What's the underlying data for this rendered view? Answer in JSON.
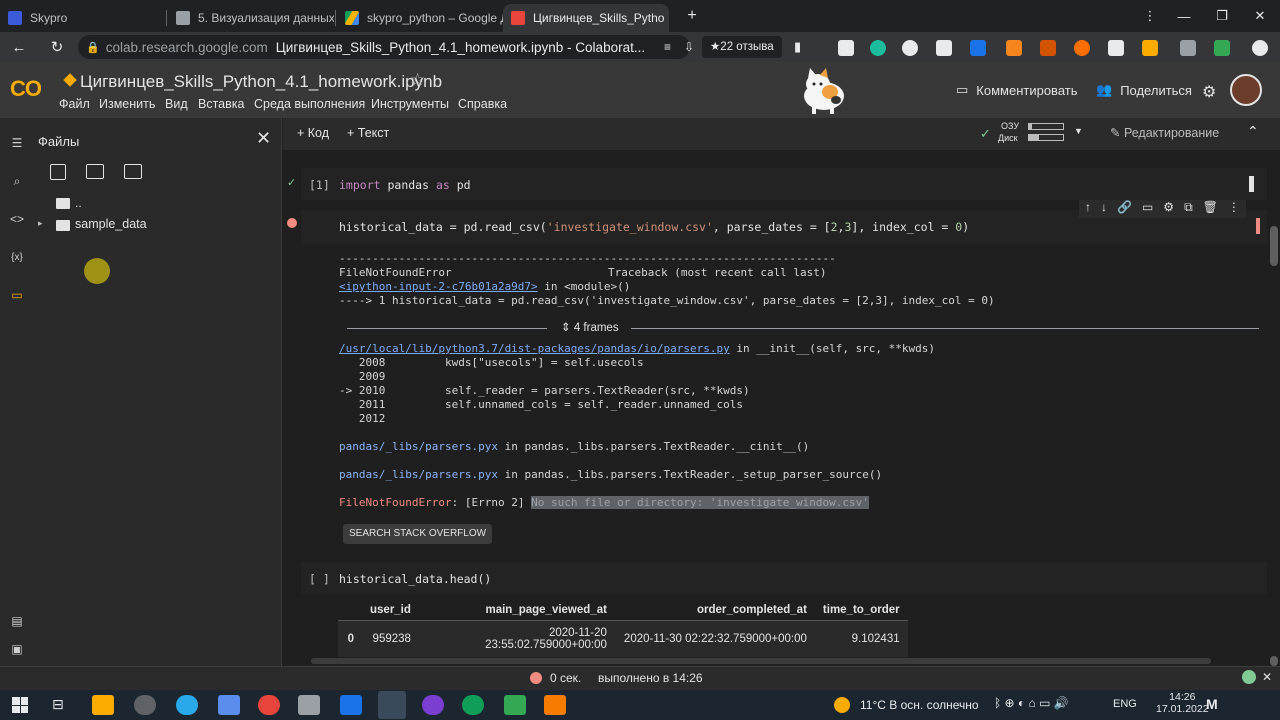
{
  "browser": {
    "tabs": [
      {
        "label": "Skypro",
        "color": "#4285f4",
        "active": false
      },
      {
        "label": "5. Визуализация данных",
        "color": "#9aa0a6",
        "active": false
      },
      {
        "label": "skypro_python – Google Д",
        "color": "#f9ab00",
        "active": false
      },
      {
        "label": "Цигвинцев_Skills_Pytho",
        "color": "#e8453c",
        "active": true
      }
    ],
    "url_host": "colab.research.google.com",
    "url_title": "Цигвинцев_Skills_Python_4.1_homework.ipynb - Colaborat...",
    "reviews_badge": "★22 отзыва"
  },
  "colab": {
    "logo": "CO",
    "notebook_title": "Цигвинцев_Skills_Python_4.1_homework.ipynb",
    "menu": [
      "Файл",
      "Изменить",
      "Вид",
      "Вставка",
      "Среда выполнения",
      "Инструменты",
      "Справка"
    ],
    "comment_label": "Комментировать",
    "share_label": "Поделиться",
    "add_code": "+ Код",
    "add_text": "+ Текст",
    "ram_label": "ОЗУ",
    "disk_label": "Диск",
    "edit_label": "Редактирование"
  },
  "files": {
    "title": "Файлы",
    "parent": "..",
    "folder": "sample_data"
  },
  "cells": {
    "c1_exec": "[1]",
    "c2_exec": "",
    "c3_exec": "[ ]",
    "c3_code": "historical_data.head()"
  },
  "traceback": {
    "dashes": "---------------------------------------------------------------------------",
    "err_name": "FileNotFoundError",
    "trace_head": "Traceback (most recent call last)",
    "ipy_link": "<ipython-input-2-c76b01a2a9d7>",
    "in_module": " in <module>()",
    "arrow_line": "----> 1 historical_data = pd.read_csv('investigate_window.csv', parse_dates = [2,3], index_col = 0)",
    "frames_label": "4 frames",
    "parsers_link": "/usr/local/lib/python3.7/dist-packages/pandas/io/parsers.py",
    "parsers_in": " in __init__(self, src, **kwds)",
    "l2008": "   2008         kwds[\"usecols\"] = self.usecols",
    "l2009": "   2009",
    "l2010": "-> 2010         self._reader = parsers.TextReader(src, **kwds)",
    "l2011": "   2011         self.unnamed_cols = self._reader.unnamed_cols",
    "l2012": "   2012",
    "pyx1_file": "pandas/_libs/parsers.pyx",
    "pyx1_rest": " in pandas._libs.parsers.TextReader.__cinit__()",
    "pyx2_file": "pandas/_libs/parsers.pyx",
    "pyx2_rest": " in pandas._libs.parsers.TextReader._setup_parser_source()",
    "final_err": "FileNotFoundError",
    "final_mid": ": [Errno 2] ",
    "final_msg": "No such file or directory: 'investigate_window.csv'",
    "so_button": "SEARCH STACK OVERFLOW"
  },
  "dataframe": {
    "columns": [
      "",
      "user_id",
      "main_page_viewed_at",
      "order_completed_at",
      "time_to_order"
    ],
    "rows": [
      [
        "0",
        "959238",
        "2020-11-20 23:55:02.759000+00:00",
        "2020-11-30 02:22:32.759000+00:00",
        "9.102431"
      ]
    ]
  },
  "status": {
    "seconds": "0 сек.",
    "done": "выполнено в 14:26"
  },
  "taskbar": {
    "weather": "11°C  В осн. солнечно",
    "lang": "ENG",
    "time": "14:26",
    "date": "17.01.2022"
  }
}
